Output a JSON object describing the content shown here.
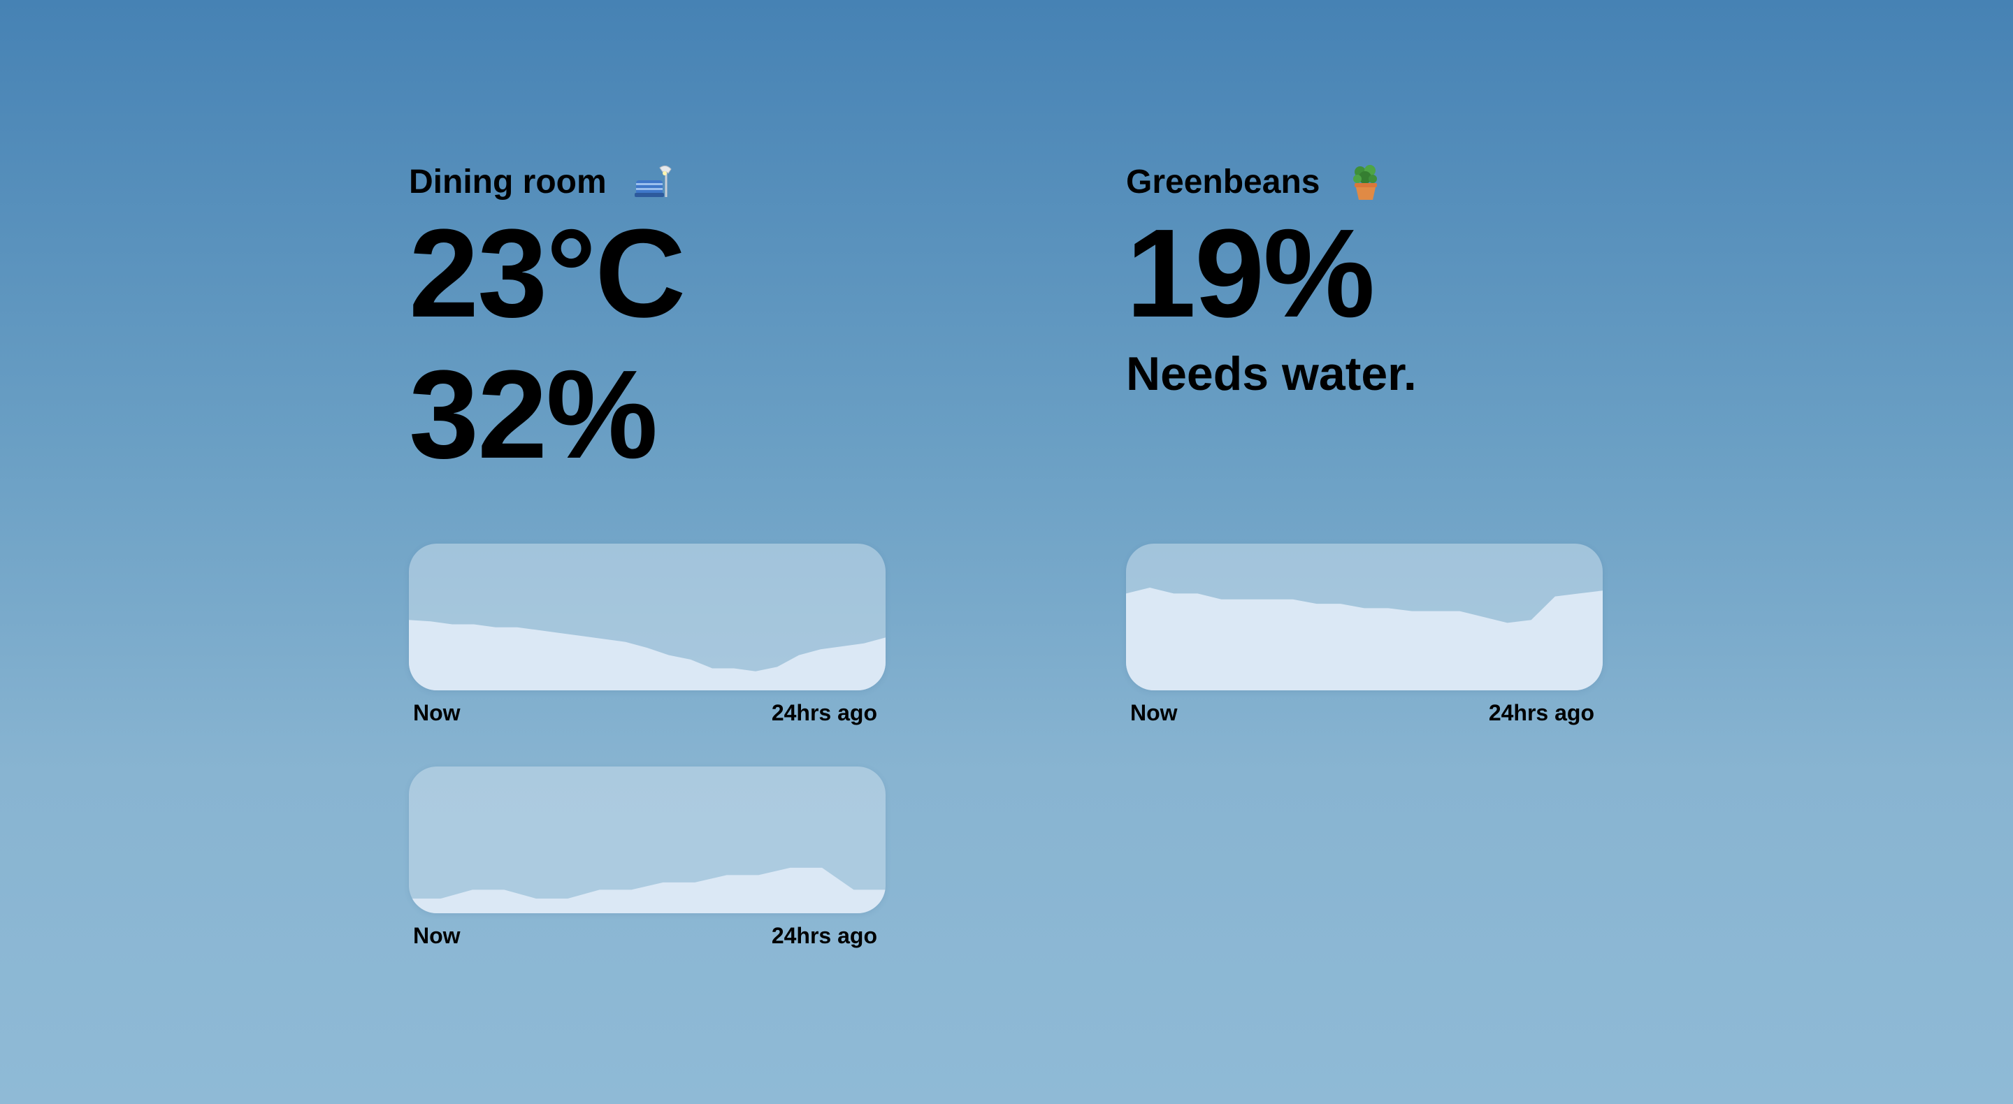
{
  "rooms": [
    {
      "title": "Dining room",
      "icon": "couch-lamp-icon",
      "temperature": "23°C",
      "humidity": "32%",
      "charts": [
        {
          "series": "temperature",
          "start_label": "Now",
          "end_label": "24hrs ago",
          "values": [
            0.48,
            0.47,
            0.45,
            0.45,
            0.43,
            0.43,
            0.41,
            0.39,
            0.37,
            0.35,
            0.33,
            0.29,
            0.24,
            0.21,
            0.15,
            0.15,
            0.13,
            0.16,
            0.24,
            0.28,
            0.3,
            0.32,
            0.36
          ]
        },
        {
          "series": "humidity",
          "start_label": "Now",
          "end_label": "24hrs ago",
          "values": [
            0.1,
            0.1,
            0.16,
            0.16,
            0.1,
            0.1,
            0.16,
            0.16,
            0.21,
            0.21,
            0.26,
            0.26,
            0.31,
            0.31,
            0.16,
            0.16
          ]
        }
      ]
    },
    {
      "title": "Greenbeans",
      "icon": "potted-plant-icon",
      "moisture": "19%",
      "status": "Needs water.",
      "charts": [
        {
          "series": "moisture",
          "start_label": "Now",
          "end_label": "24hrs ago",
          "values": [
            0.66,
            0.7,
            0.66,
            0.66,
            0.62,
            0.62,
            0.62,
            0.62,
            0.59,
            0.59,
            0.56,
            0.56,
            0.54,
            0.54,
            0.54,
            0.5,
            0.46,
            0.48,
            0.64,
            0.66,
            0.68
          ]
        }
      ]
    }
  ],
  "colors": {
    "background_top": "#4682b4",
    "background_bottom": "#8fbad6",
    "chart_area": "#dbe8f5"
  }
}
